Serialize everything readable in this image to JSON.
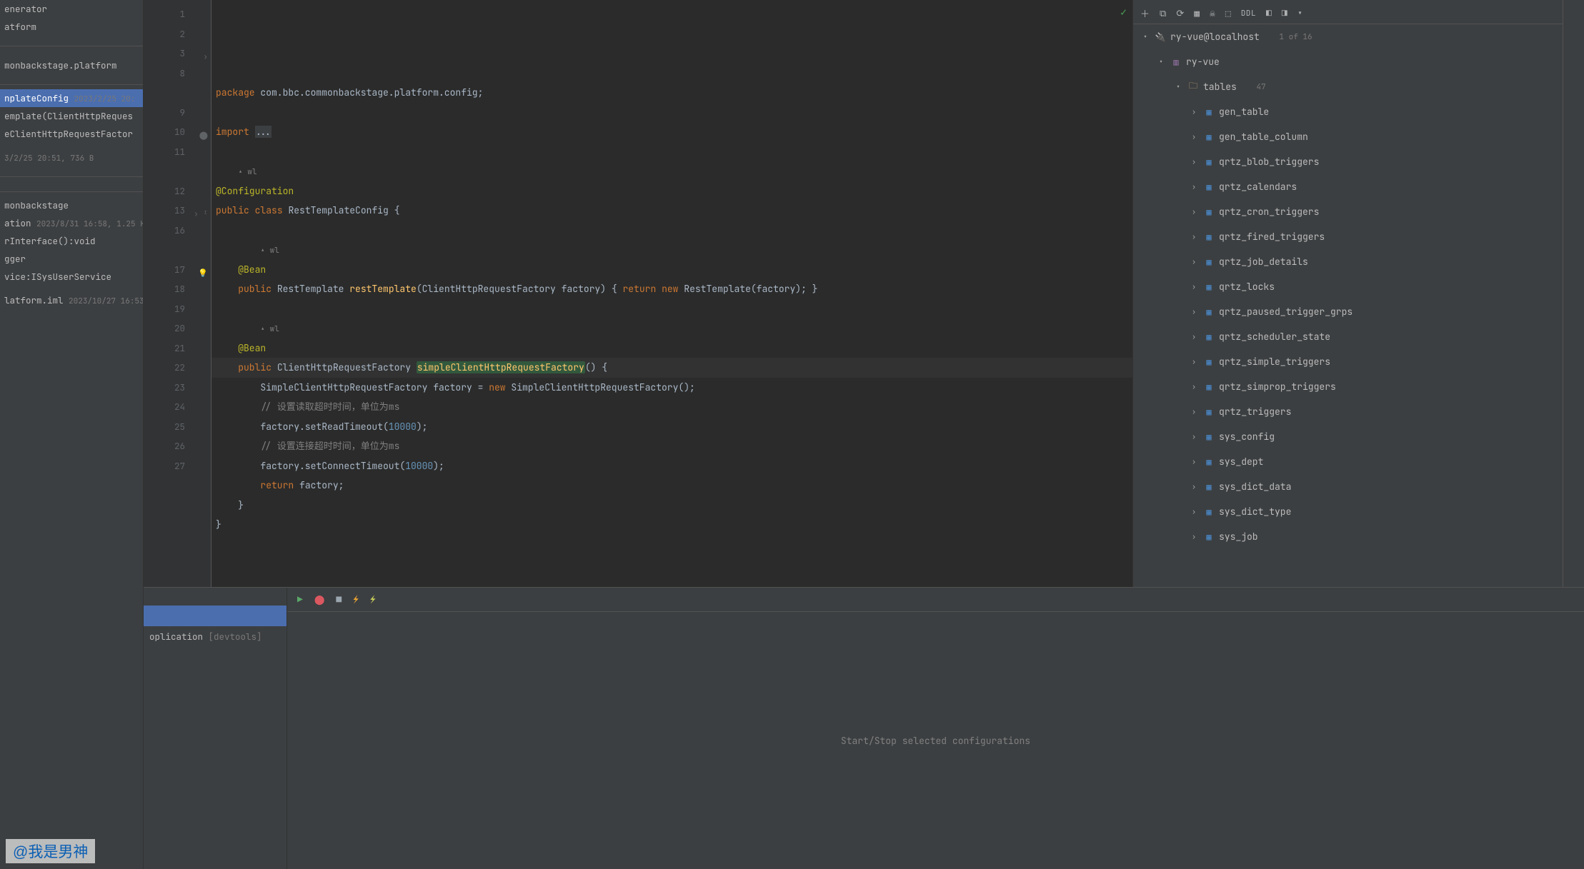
{
  "leftcol": {
    "rows": [
      {
        "txt": "enerator",
        "meta": ""
      },
      {
        "txt": "atform",
        "meta": ""
      },
      {
        "txt": " ",
        "meta": ""
      },
      {
        "txt": " ",
        "meta": ""
      },
      {
        "txt": "monbackstage.platform",
        "meta": ""
      },
      {
        "txt": " ",
        "meta": ""
      },
      {
        "txt": "nplateConfig",
        "meta": "2023/2/25 20:"
      },
      {
        "txt": "emplate(ClientHttpReques",
        "meta": ""
      },
      {
        "txt": "eClientHttpRequestFactor",
        "meta": ""
      },
      {
        "txt": " ",
        "meta": ""
      },
      {
        "txt": "",
        "meta": "3/2/25 20:51, 736 B"
      },
      {
        "txt": " ",
        "meta": ""
      },
      {
        "txt": " ",
        "meta": ""
      },
      {
        "txt": "monbackstage",
        "meta": ""
      },
      {
        "txt": "ation",
        "meta": "2023/8/31 16:58, 1.25 K"
      },
      {
        "txt": "rInterface():void",
        "meta": ""
      },
      {
        "txt": "gger",
        "meta": ""
      },
      {
        "txt": "vice:ISysUserService",
        "meta": ""
      },
      {
        "txt": " ",
        "meta": ""
      },
      {
        "txt": "latform.iml",
        "meta": "2023/10/27 16:53"
      }
    ],
    "selIdx": 6
  },
  "code": {
    "lines": [
      {
        "n": 1,
        "html": "<span class='kw'>package</span> com.bbc.commonbackstage.platform.config;"
      },
      {
        "n": 2,
        "html": ""
      },
      {
        "n": 3,
        "html": "<span class='kw'>import</span> <span style='background:#3c3f41'>...</span>",
        "gic": "›"
      },
      {
        "n": 8,
        "html": ""
      },
      {
        "n": 0,
        "html": "    <span class='auth'>▴ wl</span>"
      },
      {
        "n": 9,
        "html": "<span class='anno'>@Configuration</span>"
      },
      {
        "n": 10,
        "html": "<span class='kw'>public</span> <span class='kw'>class</span> RestTemplateConfig {",
        "gic": "⬤"
      },
      {
        "n": 11,
        "html": ""
      },
      {
        "n": 0,
        "html": "        <span class='auth'>▴ wl</span>"
      },
      {
        "n": 12,
        "html": "    <span class='anno'>@Bean</span>"
      },
      {
        "n": 13,
        "html": "    <span class='kw'>public</span> RestTemplate <span class='fn'>restTemplate</span>(ClientHttpRequestFactory factory) { <span class='kw'>return</span> <span class='kw'>new</span> RestTemplate(factory); }",
        "gic": "› ᴵ"
      },
      {
        "n": 16,
        "html": ""
      },
      {
        "n": 0,
        "html": "        <span class='auth'>▴ wl</span>"
      },
      {
        "n": 17,
        "html": "    <span class='anno'>@Bean</span>",
        "gic": "💡"
      },
      {
        "n": 18,
        "html": "    <span class='kw'>public</span> ClientHttpRequestFactory <span class='fn hl-ident'>simpleClientHttpRequestFactory</span>() {",
        "hl": true
      },
      {
        "n": 19,
        "html": "        SimpleClientHttpRequestFactory factory = <span class='kw'>new</span> SimpleClientHttpRequestFactory();"
      },
      {
        "n": 20,
        "html": "        <span class='cmt'>// 设置读取超时时间，单位为ms</span>"
      },
      {
        "n": 21,
        "html": "        factory.setReadTimeout(<span class='num'>10000</span>);"
      },
      {
        "n": 22,
        "html": "        <span class='cmt'>// 设置连接超时时间，单位为ms</span>"
      },
      {
        "n": 23,
        "html": "        factory.setConnectTimeout(<span class='num'>10000</span>);"
      },
      {
        "n": 24,
        "html": "        <span class='kw'>return</span> factory;"
      },
      {
        "n": 25,
        "html": "    }"
      },
      {
        "n": 26,
        "html": "}"
      },
      {
        "n": 27,
        "html": ""
      }
    ]
  },
  "db": {
    "toolbar": [
      "＋",
      "⧉",
      "⟳",
      "▦",
      "☠",
      "⬚",
      "DDL",
      "◧",
      "◨",
      "▾"
    ],
    "datasource": {
      "name": "ry-vue@localhost",
      "meta": "1 of 16"
    },
    "schema": "ry-vue",
    "tablesLabel": "tables",
    "tablesCount": "47",
    "tables": [
      "gen_table",
      "gen_table_column",
      "qrtz_blob_triggers",
      "qrtz_calendars",
      "qrtz_cron_triggers",
      "qrtz_fired_triggers",
      "qrtz_job_details",
      "qrtz_locks",
      "qrtz_paused_trigger_grps",
      "qrtz_scheduler_state",
      "qrtz_simple_triggers",
      "qrtz_simprop_triggers",
      "qrtz_triggers",
      "sys_config",
      "sys_dept",
      "sys_dict_data",
      "sys_dict_type",
      "sys_job"
    ]
  },
  "run": {
    "toolbarIcons": [
      "run",
      "debug",
      "stop",
      "reload",
      "profiler"
    ],
    "configRow": {
      "label": "oplication",
      "tag": "[devtools]"
    },
    "body": "Start/Stop selected configurations"
  },
  "watermark": "@我是男神"
}
